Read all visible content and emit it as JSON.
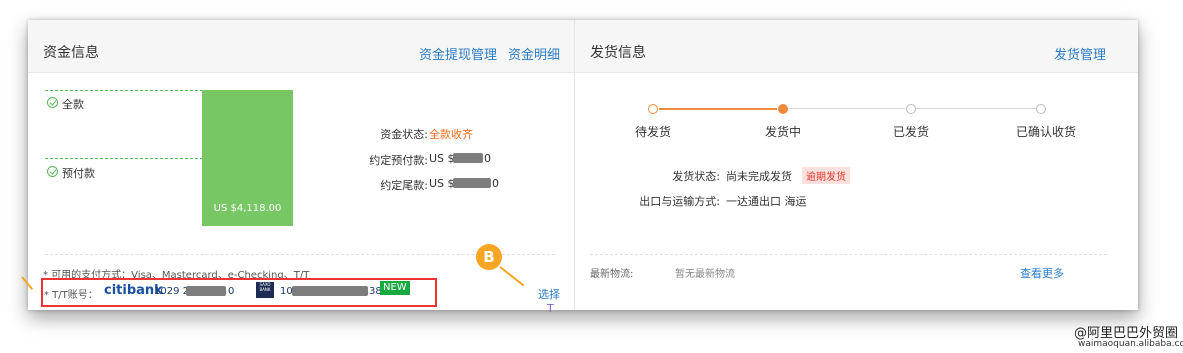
{
  "fund_panel": {
    "title": "资金信息",
    "link_withdraw": "资金提现管理",
    "link_detail": "资金明细",
    "chart": {
      "full_label": "全款",
      "prepay_label": "预付款",
      "bar_label": "US $4,118.00"
    },
    "status_label": "资金状态:",
    "status_value": "全款收齐",
    "prepay_label": "约定预付款:",
    "prepay_value_prefix": "US $",
    "prepay_value_suffix": "0",
    "tail_label": "约定尾款:",
    "tail_value_prefix": "US $",
    "tail_value_suffix": "0",
    "payment_methods": "* 可用的支付方式：Visa、Mastercard、e-Checking、T/T",
    "tt_label": "* T/T账号：",
    "bank1_name": "citibank",
    "bank1_account_prefix": "1029 2",
    "bank1_account_suffix": "0",
    "bank2_logo": "SAXO BANK",
    "bank2_account_prefix": "10",
    "bank2_account_suffix": "38",
    "new_badge": "NEW",
    "annotation_marker": "B",
    "select_link": "选择"
  },
  "ship_panel": {
    "title": "发货信息",
    "link_manage": "发货管理",
    "steps": [
      {
        "label": "待发货",
        "state": "done"
      },
      {
        "label": "发货中",
        "state": "current"
      },
      {
        "label": "已发货",
        "state": "todo"
      },
      {
        "label": "已确认收货",
        "state": "todo"
      }
    ],
    "status_label": "发货状态:",
    "status_value": "尚未完成发货",
    "overdue_tag": "逾期发货",
    "shipping_label": "出口与运输方式:",
    "shipping_value": "一达通出口 海运",
    "logistics_label": "最新物流:",
    "logistics_value": "暂无最新物流",
    "view_more": "查看更多"
  },
  "watermark": {
    "main": "@阿里巴巴外贸圈",
    "sub": "waimaoquan.alibaba.com"
  },
  "colors": {
    "accent_orange": "#f08a3c",
    "link_blue": "#2a7cc7",
    "bar_green": "#77c865",
    "highlight_red": "#e33333"
  }
}
